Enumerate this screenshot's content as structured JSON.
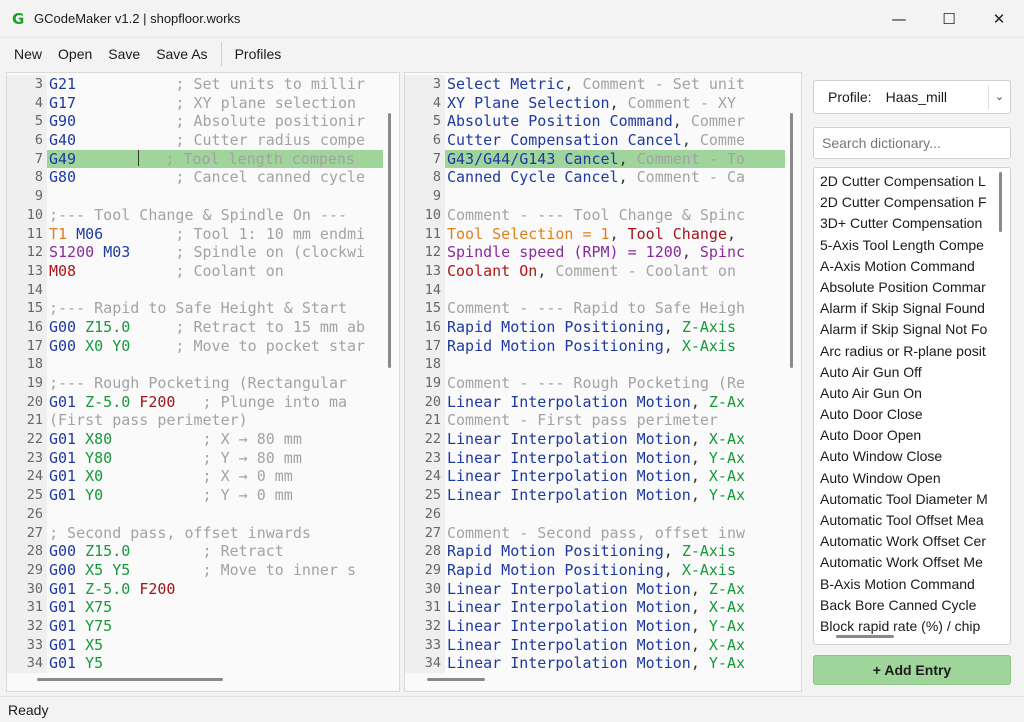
{
  "window": {
    "logo": "G",
    "title": "GCodeMaker v1.2 | shopfloor.works",
    "minimize": "—",
    "maximize": "☐",
    "close": "✕"
  },
  "menu": {
    "new": "New",
    "open": "Open",
    "save": "Save",
    "save_as": "Save As",
    "profiles": "Profiles"
  },
  "colors": {
    "highlight": "#9fd49b",
    "gcode": "#1e3aa0",
    "comment": "#a3a3a3",
    "axis": "#15993a",
    "feed": "#a0151a",
    "tool": "#e0801b",
    "spindle": "#8a2aa0"
  },
  "left_editor": {
    "lines": [
      {
        "n": "3",
        "segs": [
          [
            "G21",
            "g"
          ],
          [
            "           ; Set units to millir",
            "cmt"
          ]
        ]
      },
      {
        "n": "4",
        "segs": [
          [
            "G17",
            "g"
          ],
          [
            "           ; XY plane selection ",
            "cmt"
          ]
        ]
      },
      {
        "n": "5",
        "segs": [
          [
            "G90",
            "g"
          ],
          [
            "           ; Absolute positionir",
            "cmt"
          ]
        ]
      },
      {
        "n": "6",
        "segs": [
          [
            "G40",
            "g"
          ],
          [
            "           ; Cutter radius compe",
            "cmt"
          ]
        ]
      },
      {
        "n": "7",
        "segs": [
          [
            "G49",
            "g"
          ],
          [
            "      ",
            "def"
          ],
          [
            "CURSOR",
            "cursor"
          ],
          [
            "  ; Tool length compens",
            "cmt"
          ]
        ],
        "hl": true
      },
      {
        "n": "8",
        "segs": [
          [
            "G80",
            "g"
          ],
          [
            "           ; Cancel canned cycle",
            "cmt"
          ]
        ]
      },
      {
        "n": "9",
        "segs": []
      },
      {
        "n": "10",
        "segs": [
          [
            ";--- Tool Change & Spindle On ---",
            "cmt"
          ]
        ]
      },
      {
        "n": "11",
        "segs": [
          [
            "T1",
            "tool"
          ],
          [
            " ",
            "def"
          ],
          [
            "M06",
            "g"
          ],
          [
            "        ; Tool 1: 10 mm endmi",
            "cmt"
          ]
        ]
      },
      {
        "n": "12",
        "segs": [
          [
            "S1200",
            "spin"
          ],
          [
            " ",
            "def"
          ],
          [
            "M03",
            "g"
          ],
          [
            "     ; Spindle on (clockwi",
            "cmt"
          ]
        ]
      },
      {
        "n": "13",
        "segs": [
          [
            "M08",
            "cool"
          ],
          [
            "           ; Coolant on",
            "cmt"
          ]
        ]
      },
      {
        "n": "14",
        "segs": []
      },
      {
        "n": "15",
        "segs": [
          [
            ";--- Rapid to Safe Height & Start",
            "cmt"
          ]
        ]
      },
      {
        "n": "16",
        "segs": [
          [
            "G00",
            "g"
          ],
          [
            " ",
            "def"
          ],
          [
            "Z15.0",
            "axis"
          ],
          [
            "     ; Retract to 15 mm ab",
            "cmt"
          ]
        ]
      },
      {
        "n": "17",
        "segs": [
          [
            "G00",
            "g"
          ],
          [
            " ",
            "def"
          ],
          [
            "X0",
            "axis"
          ],
          [
            " ",
            "def"
          ],
          [
            "Y0",
            "axis"
          ],
          [
            "     ; Move to pocket star",
            "cmt"
          ]
        ]
      },
      {
        "n": "18",
        "segs": []
      },
      {
        "n": "19",
        "segs": [
          [
            ";--- Rough Pocketing (Rectangular",
            "cmt"
          ]
        ]
      },
      {
        "n": "20",
        "segs": [
          [
            "G01",
            "g"
          ],
          [
            " ",
            "def"
          ],
          [
            "Z-5.0",
            "axis"
          ],
          [
            " ",
            "def"
          ],
          [
            "F200",
            "feed"
          ],
          [
            "   ; Plunge into ma",
            "cmt"
          ]
        ]
      },
      {
        "n": "21",
        "segs": [
          [
            "(First pass perimeter)",
            "cmt"
          ]
        ]
      },
      {
        "n": "22",
        "segs": [
          [
            "G01",
            "g"
          ],
          [
            " ",
            "def"
          ],
          [
            "X80",
            "axis"
          ],
          [
            "          ; X → 80 mm",
            "cmt"
          ]
        ]
      },
      {
        "n": "23",
        "segs": [
          [
            "G01",
            "g"
          ],
          [
            " ",
            "def"
          ],
          [
            "Y80",
            "axis"
          ],
          [
            "          ; Y → 80 mm",
            "cmt"
          ]
        ]
      },
      {
        "n": "24",
        "segs": [
          [
            "G01",
            "g"
          ],
          [
            " ",
            "def"
          ],
          [
            "X0",
            "axis"
          ],
          [
            "           ; X → 0 mm",
            "cmt"
          ]
        ]
      },
      {
        "n": "25",
        "segs": [
          [
            "G01",
            "g"
          ],
          [
            " ",
            "def"
          ],
          [
            "Y0",
            "axis"
          ],
          [
            "           ; Y → 0 mm",
            "cmt"
          ]
        ]
      },
      {
        "n": "26",
        "segs": []
      },
      {
        "n": "27",
        "segs": [
          [
            "; Second pass, offset inwards",
            "cmt"
          ]
        ]
      },
      {
        "n": "28",
        "segs": [
          [
            "G00",
            "g"
          ],
          [
            " ",
            "def"
          ],
          [
            "Z15.0",
            "axis"
          ],
          [
            "        ; Retract",
            "cmt"
          ]
        ]
      },
      {
        "n": "29",
        "segs": [
          [
            "G00",
            "g"
          ],
          [
            " ",
            "def"
          ],
          [
            "X5",
            "axis"
          ],
          [
            " ",
            "def"
          ],
          [
            "Y5",
            "axis"
          ],
          [
            "        ; Move to inner s",
            "cmt"
          ]
        ]
      },
      {
        "n": "30",
        "segs": [
          [
            "G01",
            "g"
          ],
          [
            " ",
            "def"
          ],
          [
            "Z-5.0",
            "axis"
          ],
          [
            " ",
            "def"
          ],
          [
            "F200",
            "feed"
          ]
        ]
      },
      {
        "n": "31",
        "segs": [
          [
            "G01",
            "g"
          ],
          [
            " ",
            "def"
          ],
          [
            "X75",
            "axis"
          ]
        ]
      },
      {
        "n": "32",
        "segs": [
          [
            "G01",
            "g"
          ],
          [
            " ",
            "def"
          ],
          [
            "Y75",
            "axis"
          ]
        ]
      },
      {
        "n": "33",
        "segs": [
          [
            "G01",
            "g"
          ],
          [
            " ",
            "def"
          ],
          [
            "X5",
            "axis"
          ]
        ]
      },
      {
        "n": "34",
        "segs": [
          [
            "G01",
            "g"
          ],
          [
            " ",
            "def"
          ],
          [
            "Y5",
            "axis"
          ]
        ]
      }
    ]
  },
  "right_editor": {
    "lines": [
      {
        "n": "3",
        "segs": [
          [
            "Select Metric",
            "g"
          ],
          [
            ", ",
            "def"
          ],
          [
            "Comment - Set unit",
            "cmt"
          ]
        ]
      },
      {
        "n": "4",
        "segs": [
          [
            "XY Plane Selection",
            "g"
          ],
          [
            ", ",
            "def"
          ],
          [
            "Comment - XY ",
            "cmt"
          ]
        ]
      },
      {
        "n": "5",
        "segs": [
          [
            "Absolute Position Command",
            "g"
          ],
          [
            ", ",
            "def"
          ],
          [
            "Commer",
            "cmt"
          ]
        ]
      },
      {
        "n": "6",
        "segs": [
          [
            "Cutter Compensation Cancel",
            "g"
          ],
          [
            ", ",
            "def"
          ],
          [
            "Comme",
            "cmt"
          ]
        ]
      },
      {
        "n": "7",
        "segs": [
          [
            "G43/G44/G143 Cancel",
            "g"
          ],
          [
            ", ",
            "def"
          ],
          [
            "Comment - To",
            "cmt"
          ]
        ],
        "hl": true
      },
      {
        "n": "8",
        "segs": [
          [
            "Canned Cycle Cancel",
            "g"
          ],
          [
            ", ",
            "def"
          ],
          [
            "Comment - Ca",
            "cmt"
          ]
        ]
      },
      {
        "n": "9",
        "segs": []
      },
      {
        "n": "10",
        "segs": [
          [
            "Comment - --- Tool Change & Spinc",
            "cmt"
          ]
        ]
      },
      {
        "n": "11",
        "segs": [
          [
            "Tool Selection = 1",
            "tool"
          ],
          [
            ", ",
            "def"
          ],
          [
            "Tool Change",
            "feed"
          ],
          [
            ",",
            "def"
          ]
        ]
      },
      {
        "n": "12",
        "segs": [
          [
            "Spindle speed (RPM) = 1200",
            "spin"
          ],
          [
            ", ",
            "def"
          ],
          [
            "Spinc",
            "spin"
          ]
        ]
      },
      {
        "n": "13",
        "segs": [
          [
            "Coolant On",
            "cool"
          ],
          [
            ", ",
            "def"
          ],
          [
            "Comment - Coolant on",
            "cmt"
          ]
        ]
      },
      {
        "n": "14",
        "segs": []
      },
      {
        "n": "15",
        "segs": [
          [
            "Comment - --- Rapid to Safe Heigh",
            "cmt"
          ]
        ]
      },
      {
        "n": "16",
        "segs": [
          [
            "Rapid Motion Positioning",
            "g"
          ],
          [
            ", ",
            "def"
          ],
          [
            "Z-Axis",
            "axis"
          ]
        ]
      },
      {
        "n": "17",
        "segs": [
          [
            "Rapid Motion Positioning",
            "g"
          ],
          [
            ", ",
            "def"
          ],
          [
            "X-Axis",
            "axis"
          ]
        ]
      },
      {
        "n": "18",
        "segs": []
      },
      {
        "n": "19",
        "segs": [
          [
            "Comment - --- Rough Pocketing (Re",
            "cmt"
          ]
        ]
      },
      {
        "n": "20",
        "segs": [
          [
            "Linear Interpolation Motion",
            "g"
          ],
          [
            ", ",
            "def"
          ],
          [
            "Z-Ax",
            "axis"
          ]
        ]
      },
      {
        "n": "21",
        "segs": [
          [
            "Comment - First pass perimeter",
            "cmt"
          ]
        ]
      },
      {
        "n": "22",
        "segs": [
          [
            "Linear Interpolation Motion",
            "g"
          ],
          [
            ", ",
            "def"
          ],
          [
            "X-Ax",
            "axis"
          ]
        ]
      },
      {
        "n": "23",
        "segs": [
          [
            "Linear Interpolation Motion",
            "g"
          ],
          [
            ", ",
            "def"
          ],
          [
            "Y-Ax",
            "axis"
          ]
        ]
      },
      {
        "n": "24",
        "segs": [
          [
            "Linear Interpolation Motion",
            "g"
          ],
          [
            ", ",
            "def"
          ],
          [
            "X-Ax",
            "axis"
          ]
        ]
      },
      {
        "n": "25",
        "segs": [
          [
            "Linear Interpolation Motion",
            "g"
          ],
          [
            ", ",
            "def"
          ],
          [
            "Y-Ax",
            "axis"
          ]
        ]
      },
      {
        "n": "26",
        "segs": []
      },
      {
        "n": "27",
        "segs": [
          [
            "Comment - Second pass, offset inw",
            "cmt"
          ]
        ]
      },
      {
        "n": "28",
        "segs": [
          [
            "Rapid Motion Positioning",
            "g"
          ],
          [
            ", ",
            "def"
          ],
          [
            "Z-Axis",
            "axis"
          ]
        ]
      },
      {
        "n": "29",
        "segs": [
          [
            "Rapid Motion Positioning",
            "g"
          ],
          [
            ", ",
            "def"
          ],
          [
            "X-Axis",
            "axis"
          ]
        ]
      },
      {
        "n": "30",
        "segs": [
          [
            "Linear Interpolation Motion",
            "g"
          ],
          [
            ", ",
            "def"
          ],
          [
            "Z-Ax",
            "axis"
          ]
        ]
      },
      {
        "n": "31",
        "segs": [
          [
            "Linear Interpolation Motion",
            "g"
          ],
          [
            ", ",
            "def"
          ],
          [
            "X-Ax",
            "axis"
          ]
        ]
      },
      {
        "n": "32",
        "segs": [
          [
            "Linear Interpolation Motion",
            "g"
          ],
          [
            ", ",
            "def"
          ],
          [
            "Y-Ax",
            "axis"
          ]
        ]
      },
      {
        "n": "33",
        "segs": [
          [
            "Linear Interpolation Motion",
            "g"
          ],
          [
            ", ",
            "def"
          ],
          [
            "X-Ax",
            "axis"
          ]
        ]
      },
      {
        "n": "34",
        "segs": [
          [
            "Linear Interpolation Motion",
            "g"
          ],
          [
            ", ",
            "def"
          ],
          [
            "Y-Ax",
            "axis"
          ]
        ]
      }
    ]
  },
  "sidebar": {
    "profile_label": "Profile:",
    "profile_value": "Haas_mill",
    "profile_chevron": "⌄",
    "search_placeholder": "Search dictionary...",
    "dictionary": [
      "2D Cutter Compensation L",
      "2D Cutter Compensation F",
      "3D+ Cutter Compensation",
      "5-Axis Tool Length Compe",
      "A-Axis Motion Command",
      "Absolute Position Commar",
      "Alarm if Skip Signal Found",
      "Alarm if Skip Signal Not Fo",
      "Arc radius or R-plane posit",
      "Auto Air Gun Off",
      "Auto Air Gun On",
      "Auto Door Close",
      "Auto Door Open",
      "Auto Window Close",
      "Auto Window Open",
      "Automatic Tool Diameter M",
      "Automatic Tool Offset Mea",
      "Automatic Work Offset Cer",
      "Automatic Work Offset Me",
      "B-Axis Motion Command",
      "Back Bore Canned Cycle",
      "Block rapid rate (%) / chip"
    ],
    "add_button": "+ Add Entry"
  },
  "status": {
    "text": "Ready"
  }
}
